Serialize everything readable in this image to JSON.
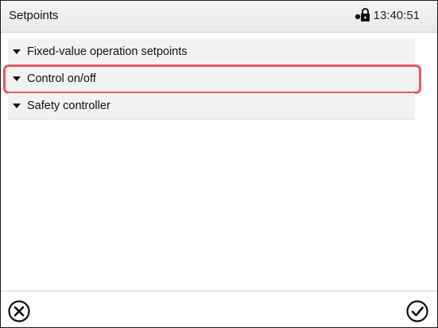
{
  "header": {
    "title": "Setpoints",
    "time": "13:40:51",
    "lock_icon": "lock-icon"
  },
  "menu": {
    "items": [
      {
        "label": "Fixed-value operation setpoints",
        "selected": false
      },
      {
        "label": "Control on/off",
        "selected": true
      },
      {
        "label": "Safety controller",
        "selected": false
      }
    ]
  },
  "footer": {
    "cancel_icon": "circled-x-icon",
    "confirm_icon": "circled-check-icon"
  },
  "colors": {
    "selection_outline": "#e05a64",
    "item_background": "#f2f2f2"
  }
}
